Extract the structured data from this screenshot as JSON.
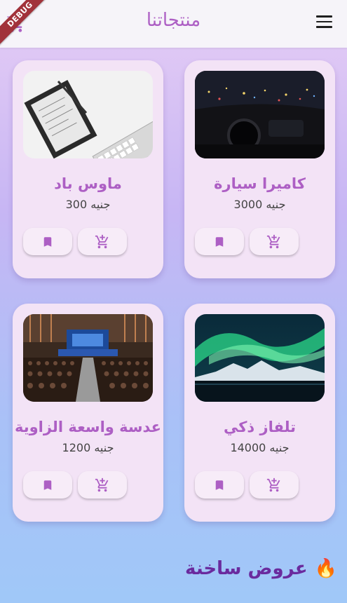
{
  "appbar": {
    "title": "منتجاتنا",
    "menu_icon": "menu-icon",
    "cart_icon": "cart-icon"
  },
  "debug_banner": "DEBUG",
  "products": [
    {
      "name": "كاميرا سيارة",
      "price": "3000 جنيه",
      "image": "car-dashboard-night-photo"
    },
    {
      "name": "ماوس باد",
      "price": "300 جنيه",
      "image": "desk-notebook-keyboard-photo"
    },
    {
      "name": "تلفاز ذكي",
      "price": "14000 جنيه",
      "image": "aurora-mountains-photo"
    },
    {
      "name": "عدسة واسعة الزاوية",
      "price": "1200 جنيه",
      "image": "conference-hall-photo"
    }
  ],
  "section": {
    "title": "عروض ساخنة",
    "icon": "🔥"
  },
  "colors": {
    "accent": "#ad5fc4",
    "card_bg": "#f3e3f6",
    "section_title": "#6a2a9e",
    "ribbon": "#a1323a"
  }
}
